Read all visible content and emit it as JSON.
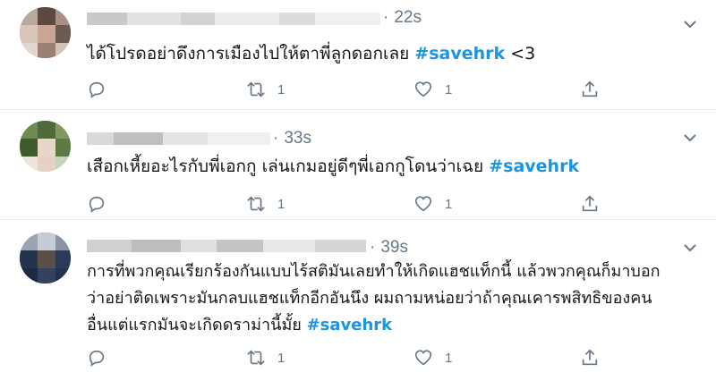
{
  "tweets": [
    {
      "time": "22s",
      "text_before": "ได้โปรดอย่าดึงการเมืองไปให้ตาพี่ลูกดอกเลย ",
      "hashtag": "#savehrk",
      "text_after": " <3",
      "retweets": "1",
      "likes": "1"
    },
    {
      "time": "33s",
      "text_before": "เสือกเหี้ยอะไรกับพี่เอกกู เล่นเกมอยู่ดีๆพี่เอกกูโดนว่าเฉย ",
      "hashtag": "#savehrk",
      "text_after": "",
      "retweets": "1",
      "likes": "1"
    },
    {
      "time": "39s",
      "lines": [
        "การที่พวกคุณเรียกร้องกันแบบไร้สติมันเลยทำให้เกิดแฮชแท็กนี้ แล้วพวกคุณก็มาบอก",
        "ว่าอย่าติดเพราะมันกลบแฮชแท็กอีกอันนึง  ผมถามหน่อยว่าถ้าคุณเคารพสิทธิของคน"
      ],
      "text_before": "อื่นแต่แรกมันจะเกิดดราม่านี้มั้ย ",
      "hashtag": "#savehrk",
      "text_after": "",
      "retweets": "1",
      "likes": "1"
    }
  ],
  "icons": {
    "reply": "reply-icon",
    "retweet": "retweet-icon",
    "like": "like-icon",
    "share": "share-icon",
    "caret": "chevron-down-icon"
  },
  "colors": {
    "hashtag": "#1b95e0",
    "meta": "#657786",
    "divider": "#e6ecf0"
  }
}
